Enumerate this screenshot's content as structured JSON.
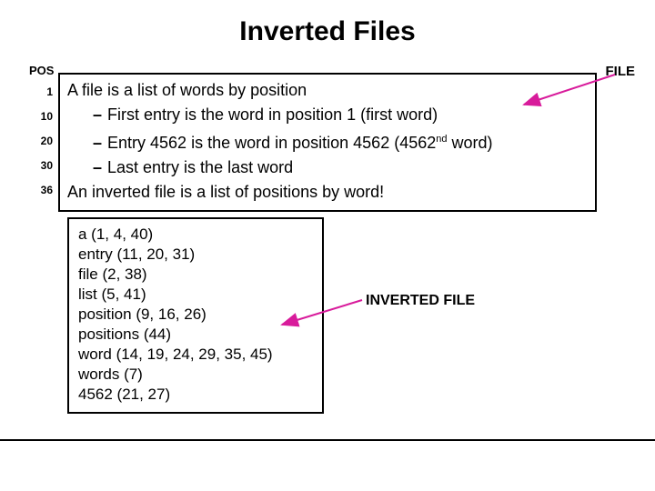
{
  "title": "Inverted Files",
  "pos_label": "POS",
  "file_label": "FILE",
  "pos_numbers": [
    "1",
    "10",
    "20",
    "30",
    "36"
  ],
  "file_lines": {
    "l1": "A file is a list of words by position",
    "l2": "First entry is the word in position 1 (first word)",
    "l3_pre": "Entry 4562 is the word in position 4562 (4562",
    "l3_sup": "nd",
    "l3_post": " word)",
    "l4": "Last entry is the last word",
    "l5": "An inverted file is a list of positions by word!"
  },
  "dash": "–",
  "inverted_label": "INVERTED FILE",
  "inverted_lines": [
    "a (1, 4, 40)",
    "entry (11, 20, 31)",
    "file (2, 38)",
    "list (5, 41)",
    "position (9, 16, 26)",
    "positions (44)",
    "word (14, 19, 24, 29, 35, 45)",
    "words (7)",
    "4562 (21, 27)"
  ]
}
